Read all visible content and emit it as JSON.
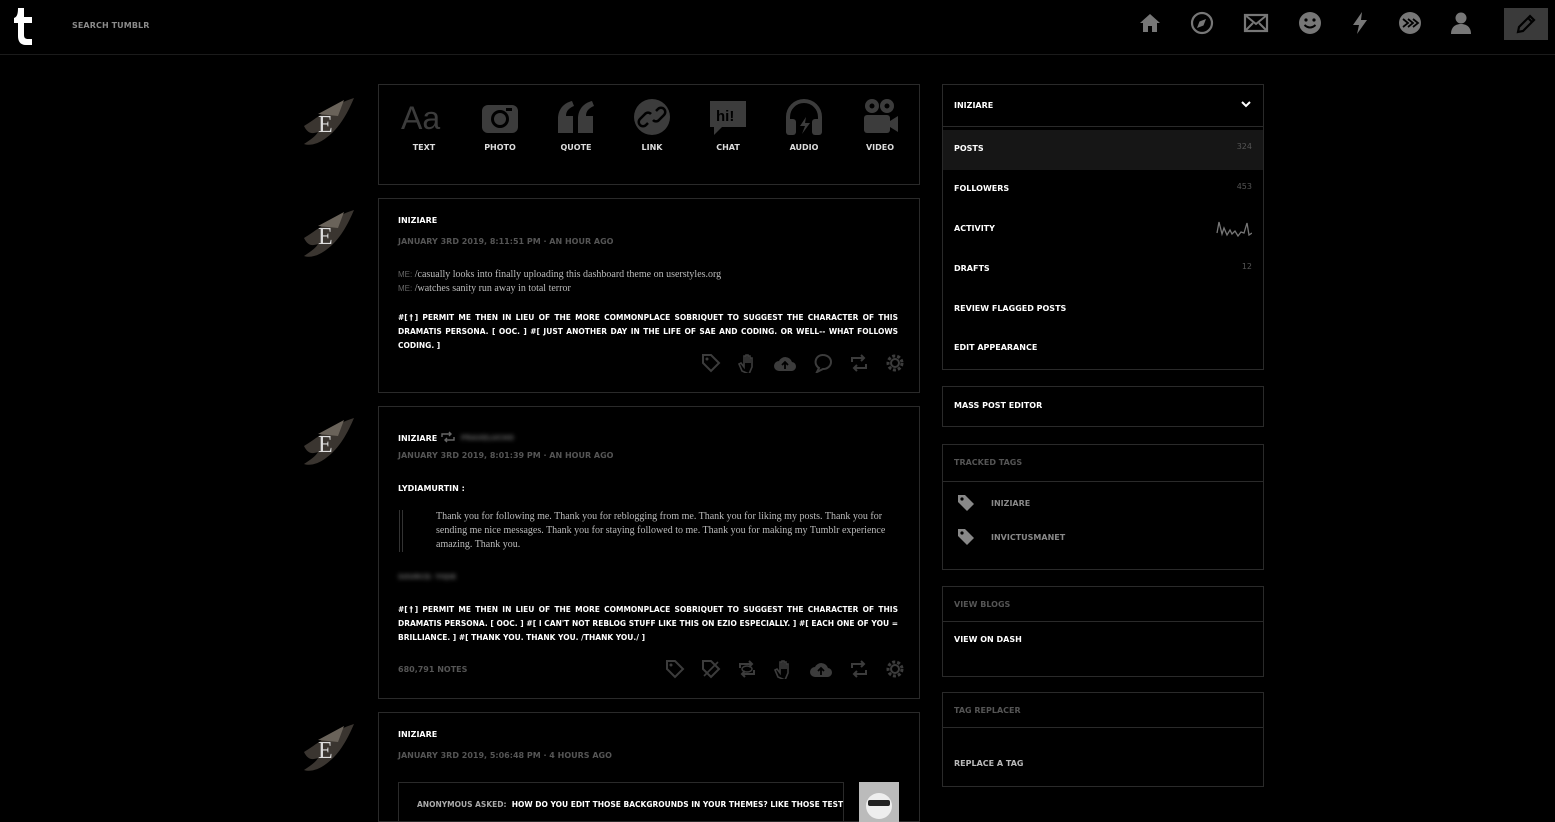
{
  "header": {
    "search_placeholder": "SEARCH TUMBLR",
    "nav": [
      "home-icon",
      "explore-icon",
      "mail-icon",
      "messaging-icon",
      "activity-icon",
      "patio-icon",
      "account-icon",
      "compose-icon"
    ]
  },
  "post_types": [
    {
      "label": "TEXT"
    },
    {
      "label": "PHOTO"
    },
    {
      "label": "QUOTE"
    },
    {
      "label": "LINK"
    },
    {
      "label": "CHAT"
    },
    {
      "label": "AUDIO"
    },
    {
      "label": "VIDEO"
    }
  ],
  "post1": {
    "blog": "INIZIARE",
    "date": "JANUARY 3RD 2019, 8:11:51 PM · AN HOUR AGO",
    "line1_prefix": "ME:",
    "line1": "/casually looks into finally uploading this dashboard theme on userstyles.org",
    "line2_prefix": "ME:",
    "line2": "/watches sanity run away in total terror",
    "tags": "#[†] PERMIT ME THEN IN LIEU OF THE MORE COMMONPLACE SOBRIQUET TO SUGGEST THE CHARACTER OF THIS DRAMATIS PERSONA. [ OOC. ]     #[ JUST ANOTHER DAY IN THE LIFE OF SAE AND CODING. OR WELL-- WHAT FOLLOWS CODING. ]"
  },
  "post2": {
    "blog": "INIZIARE",
    "reblog_from": "PRAXELUCHO",
    "date": "JANUARY 3RD 2019, 8:01:39 PM · AN HOUR AGO",
    "source_user": "LYDIAMURTIN :",
    "quote": "Thank you for following me. Thank you for reblogging from me. Thank you for liking my posts. Thank you for sending me nice messages. Thank you for staying followed to me. Thank you for making my Tumblr experience amazing. Thank you.",
    "source": "SOURCE: YIQIE",
    "tags": "#[†] PERMIT ME THEN IN LIEU OF THE MORE COMMONPLACE SOBRIQUET TO SUGGEST THE CHARACTER OF THIS DRAMATIS PERSONA. [ OOC. ]     #[ I CAN'T NOT REBLOG STUFF LIKE THIS ON EZIO ESPECIALLY. ]     #[ EACH ONE OF YOU = BRILLIANCE. ]     #[ THANK YOU. THANK YOU. /THANK YOU./ ]",
    "notes": "680,791 NOTES"
  },
  "post3": {
    "blog": "INIZIARE",
    "date": "JANUARY 3RD 2019, 5:06:48 PM · 4 HOURS AGO",
    "ask_label": "ANONYMOUS ASKED:",
    "ask": "HOW DO YOU EDIT THOSE BACKGROUNDS IN YOUR THEMES? LIKE THOSE TEST"
  },
  "sidebar": {
    "blog_title": "INIZIARE",
    "items": [
      {
        "label": "POSTS",
        "count": "324"
      },
      {
        "label": "FOLLOWERS",
        "count": "453"
      },
      {
        "label": "ACTIVITY",
        "count": ""
      },
      {
        "label": "DRAFTS",
        "count": "12"
      },
      {
        "label": "REVIEW FLAGGED POSTS",
        "count": ""
      },
      {
        "label": "EDIT APPEARANCE",
        "count": ""
      }
    ],
    "mass_post_editor": "MASS POST EDITOR",
    "tracked_tags_title": "TRACKED TAGS",
    "tracked_tags": [
      "INIZIARE",
      "INVICTUSMANET"
    ],
    "view_blogs_title": "VIEW BLOGS",
    "view_on_dash": "VIEW ON DASH",
    "tag_replacer_title": "TAG REPLACER",
    "replace_a_tag": "REPLACE A TAG"
  },
  "colors": {
    "background": "#000000",
    "border": "#2a2a2a",
    "icon": "#3c3c3c",
    "text": "#ffffff",
    "muted": "#555555"
  }
}
